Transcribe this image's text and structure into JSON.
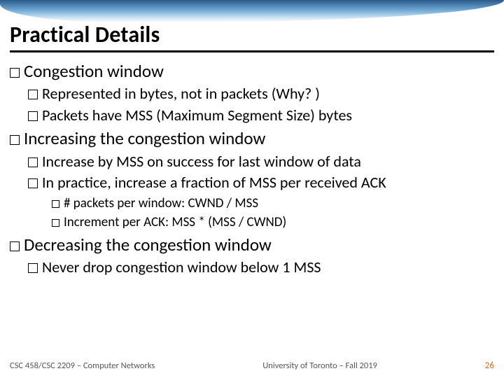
{
  "title": "Practical Details",
  "sections": [
    {
      "heading": "Congestion window",
      "items": [
        {
          "text": "Represented in bytes, not in packets (Why? )"
        },
        {
          "text": "Packets have MSS (Maximum Segment Size) bytes"
        }
      ]
    },
    {
      "heading": "Increasing the congestion window",
      "items": [
        {
          "text": "Increase by MSS on success for last window of data"
        },
        {
          "text": "In practice, increase a fraction of MSS per received ACK",
          "sub": [
            "# packets per window: CWND / MSS",
            "Increment per ACK: MSS * (MSS / CWND)"
          ]
        }
      ]
    },
    {
      "heading": "Decreasing the congestion window",
      "items": [
        {
          "text": "Never drop congestion window below 1 MSS"
        }
      ]
    }
  ],
  "footer": {
    "left": "CSC 458/CSC 2209 – Computer Networks",
    "center": "University of Toronto – Fall 2019",
    "page": "26"
  }
}
